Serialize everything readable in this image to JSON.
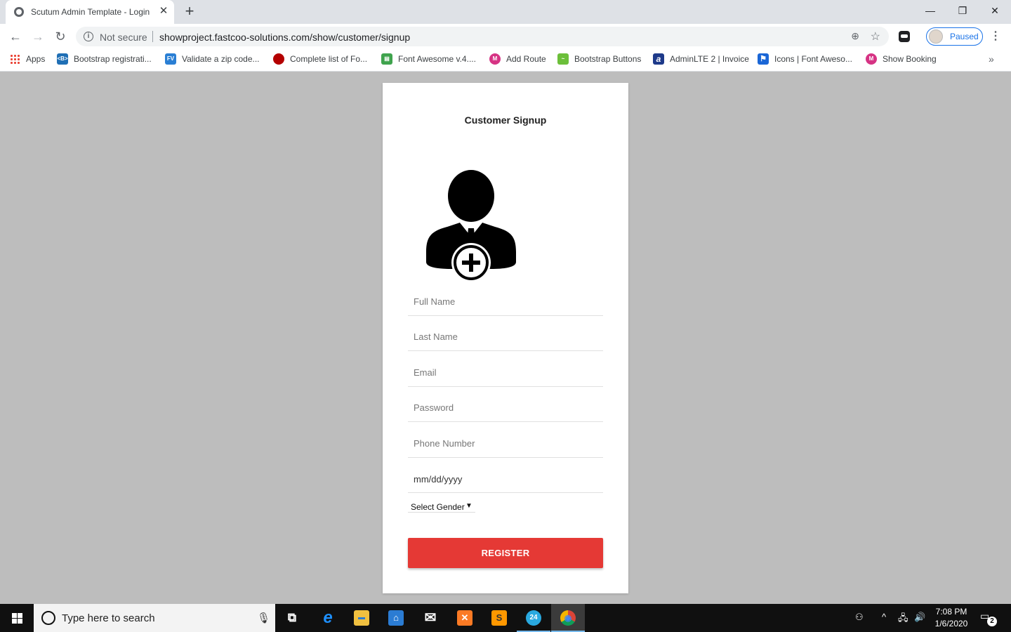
{
  "browser": {
    "tab_title": "Scutum Admin Template - Login",
    "tab_close": "✕",
    "new_tab": "+",
    "window": {
      "minimize": "—",
      "restore": "❐",
      "close": "✕"
    },
    "nav": {
      "back": "←",
      "forward": "→",
      "reload": "↻"
    },
    "security_label": "Not secure",
    "url": "showproject.fastcoo-solutions.com/show/customer/signup",
    "zoom_icon": "⊕",
    "star_icon": "☆",
    "profile_status": "Paused",
    "menu": "⋮"
  },
  "bookmarks": {
    "items": [
      {
        "label": "Apps",
        "icon": "apps-grid-icon"
      },
      {
        "label": "Bootstrap registrati...",
        "icon": "bootstrap-icon",
        "color": "#1f6fb5",
        "glyph": "<B>"
      },
      {
        "label": "Validate a zip code...",
        "icon": "formvalidation-icon",
        "color": "#2a7fd4",
        "glyph": "FV"
      },
      {
        "label": "Complete list of Fo...",
        "icon": "red-circle-icon",
        "color": "#b40000",
        "glyph": ""
      },
      {
        "label": "Font Awesome v.4....",
        "icon": "document-icon",
        "color": "#3fa34d",
        "glyph": "▤"
      },
      {
        "label": "Add Route",
        "icon": "pink-circle-icon",
        "color": "#d63384",
        "glyph": "M"
      },
      {
        "label": "Bootstrap Buttons",
        "icon": "chart-icon",
        "color": "#6cbf3a",
        "glyph": "~"
      },
      {
        "label": "AdminLTE 2 | Invoice",
        "icon": "adminlte-icon",
        "color": "#1e3a8a",
        "glyph": "a"
      },
      {
        "label": "Icons | Font Aweso...",
        "icon": "flag-icon",
        "color": "#1a66d6",
        "glyph": "⚑"
      },
      {
        "label": "Show Booking",
        "icon": "pink-circle-icon",
        "color": "#d63384",
        "glyph": "M"
      }
    ],
    "more": "»"
  },
  "signup": {
    "title": "Customer Signup",
    "fields": {
      "full_name": "Full Name",
      "last_name": "Last Name",
      "email": "Email",
      "password": "Password",
      "phone": "Phone Number",
      "date": "mm/dd/yyyy"
    },
    "gender_select": "Select Gender",
    "gender_arrow": "▼",
    "register_label": "REGISTER",
    "accent_color": "#e53935"
  },
  "taskbar": {
    "search_placeholder": "Type here to search",
    "mic": "🎙",
    "apps": [
      {
        "name": "task-view-icon",
        "glyph": "⧉",
        "color": "transparent"
      },
      {
        "name": "edge-icon",
        "glyph": "e",
        "color": "#0078d7"
      },
      {
        "name": "file-explorer-icon",
        "glyph": "▬",
        "color": "#f0c040"
      },
      {
        "name": "store-icon",
        "glyph": "⌂",
        "color": "#2b7cd3"
      },
      {
        "name": "mail-icon",
        "glyph": "✉",
        "color": "transparent"
      },
      {
        "name": "xampp-icon",
        "glyph": "✕",
        "color": "#fb7a24"
      },
      {
        "name": "sublime-text-icon",
        "glyph": "S",
        "color": "#ff9800"
      },
      {
        "name": "anydesk-24-icon",
        "glyph": "24",
        "color": "#29a9e0"
      },
      {
        "name": "chrome-icon",
        "glyph": "◉",
        "color": "#db4437"
      }
    ],
    "tray": {
      "people": "⚇",
      "chevron": "^",
      "network": "🖧",
      "volume": "🔊"
    },
    "time": "7:08 PM",
    "date": "1/6/2020",
    "notification_count": "2"
  }
}
